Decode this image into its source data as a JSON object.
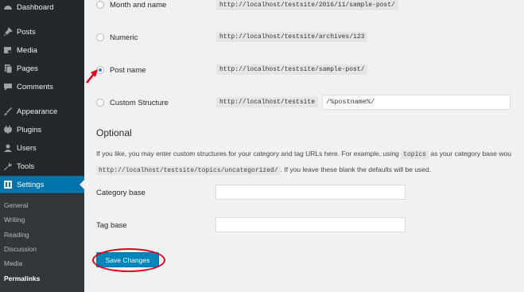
{
  "sidebar": {
    "items": [
      {
        "label": "Dashboard",
        "icon": "dashboard-icon"
      },
      {
        "label": "Posts",
        "icon": "pin-icon"
      },
      {
        "label": "Media",
        "icon": "media-icon"
      },
      {
        "label": "Pages",
        "icon": "pages-icon"
      },
      {
        "label": "Comments",
        "icon": "comments-icon"
      },
      {
        "label": "Appearance",
        "icon": "brush-icon"
      },
      {
        "label": "Plugins",
        "icon": "plugin-icon"
      },
      {
        "label": "Users",
        "icon": "users-icon"
      },
      {
        "label": "Tools",
        "icon": "wrench-icon"
      },
      {
        "label": "Settings",
        "icon": "settings-icon"
      }
    ],
    "submenu": [
      "General",
      "Writing",
      "Reading",
      "Discussion",
      "Media",
      "Permalinks"
    ]
  },
  "permalinks": {
    "options": [
      {
        "label": "Month and name",
        "example": "http://localhost/testsite/2016/11/sample-post/",
        "checked": false
      },
      {
        "label": "Numeric",
        "example": "http://localhost/testsite/archives/123",
        "checked": false
      },
      {
        "label": "Post name",
        "example": "http://localhost/testsite/sample-post/",
        "checked": true
      },
      {
        "label": "Custom Structure",
        "example": "http://localhost/testsite",
        "checked": false
      }
    ],
    "custom_value": "/%postname%/"
  },
  "optional": {
    "title": "Optional",
    "desc_part1": "If you like, you may enter custom structures for your category and tag URLs here. For example, using",
    "desc_code1": "topics",
    "desc_part2": "as your category base wou",
    "desc_code2": "http://localhost/testsite/topics/uncategorized/",
    "desc_part3": ". If you leave these blank the defaults will be used.",
    "category_label": "Category base",
    "tag_label": "Tag base",
    "category_value": "",
    "tag_value": ""
  },
  "save_label": "Save Changes",
  "colors": {
    "sidebar": "#23282d",
    "active": "#0073aa",
    "annotation": "#e0001b"
  }
}
